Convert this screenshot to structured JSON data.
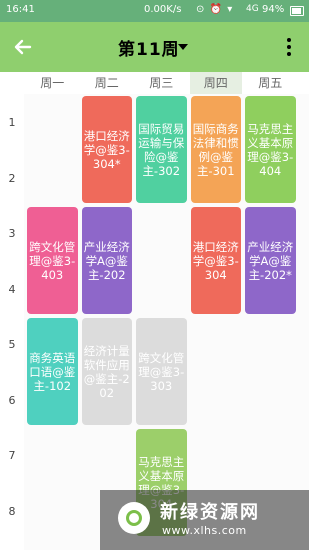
{
  "status_bar": {
    "time": "16:41",
    "speed": "0.00K/s",
    "network": "4G",
    "battery": "94%"
  },
  "toolbar": {
    "title": "第11周"
  },
  "days": [
    "周一",
    "周二",
    "周三",
    "周四",
    "周五"
  ],
  "today_index": 3,
  "periods": [
    "1",
    "2",
    "3",
    "4",
    "5",
    "6",
    "7",
    "8"
  ],
  "courses": [
    {
      "name": "港口经济学@鉴3-304*",
      "day": 1,
      "start": 1,
      "span": 2,
      "color": "#ef6a5b"
    },
    {
      "name": "国际贸易运输与保险@鉴主-302",
      "day": 2,
      "start": 1,
      "span": 2,
      "color": "#50d0a0"
    },
    {
      "name": "国际商务法律和惯例@鉴主-301",
      "day": 3,
      "start": 1,
      "span": 2,
      "color": "#f4a456"
    },
    {
      "name": "马克思主义基本原理@鉴3-404",
      "day": 4,
      "start": 1,
      "span": 2,
      "color": "#8fcf5e"
    },
    {
      "name": "跨文化管理@鉴3-403",
      "day": 0,
      "start": 3,
      "span": 2,
      "color": "#ef5f94"
    },
    {
      "name": "产业经济学A@鉴主-202",
      "day": 1,
      "start": 3,
      "span": 2,
      "color": "#8e67c9"
    },
    {
      "name": "港口经济学@鉴3-304",
      "day": 3,
      "start": 3,
      "span": 2,
      "color": "#ef6a5b"
    },
    {
      "name": "产业经济学A@鉴主-202*",
      "day": 4,
      "start": 3,
      "span": 2,
      "color": "#8e67c9"
    },
    {
      "name": "商务英语口语@鉴主-102",
      "day": 0,
      "start": 5,
      "span": 2,
      "color": "#4fd0bf"
    },
    {
      "name": "经济计量软件应用@鉴主-202",
      "day": 1,
      "start": 5,
      "span": 2,
      "color": "#dcdcdc"
    },
    {
      "name": "跨文化管理@鉴3-303",
      "day": 2,
      "start": 5,
      "span": 2,
      "color": "#dcdcdc"
    },
    {
      "name": "马克思主义基本原理@鉴3-304",
      "day": 2,
      "start": 7,
      "span": 2,
      "color": "#9ccf6a"
    }
  ],
  "watermark": {
    "title": "新绿资源网",
    "url": "www.xlhs.com"
  },
  "icons": {
    "back": "arrow-left-icon",
    "dropdown": "caret-down-icon",
    "menu": "more-vert-icon"
  },
  "colors": {
    "status_bar": "#66b07a",
    "toolbar": "#8fcf6e",
    "today_header": "#e6efe2"
  }
}
